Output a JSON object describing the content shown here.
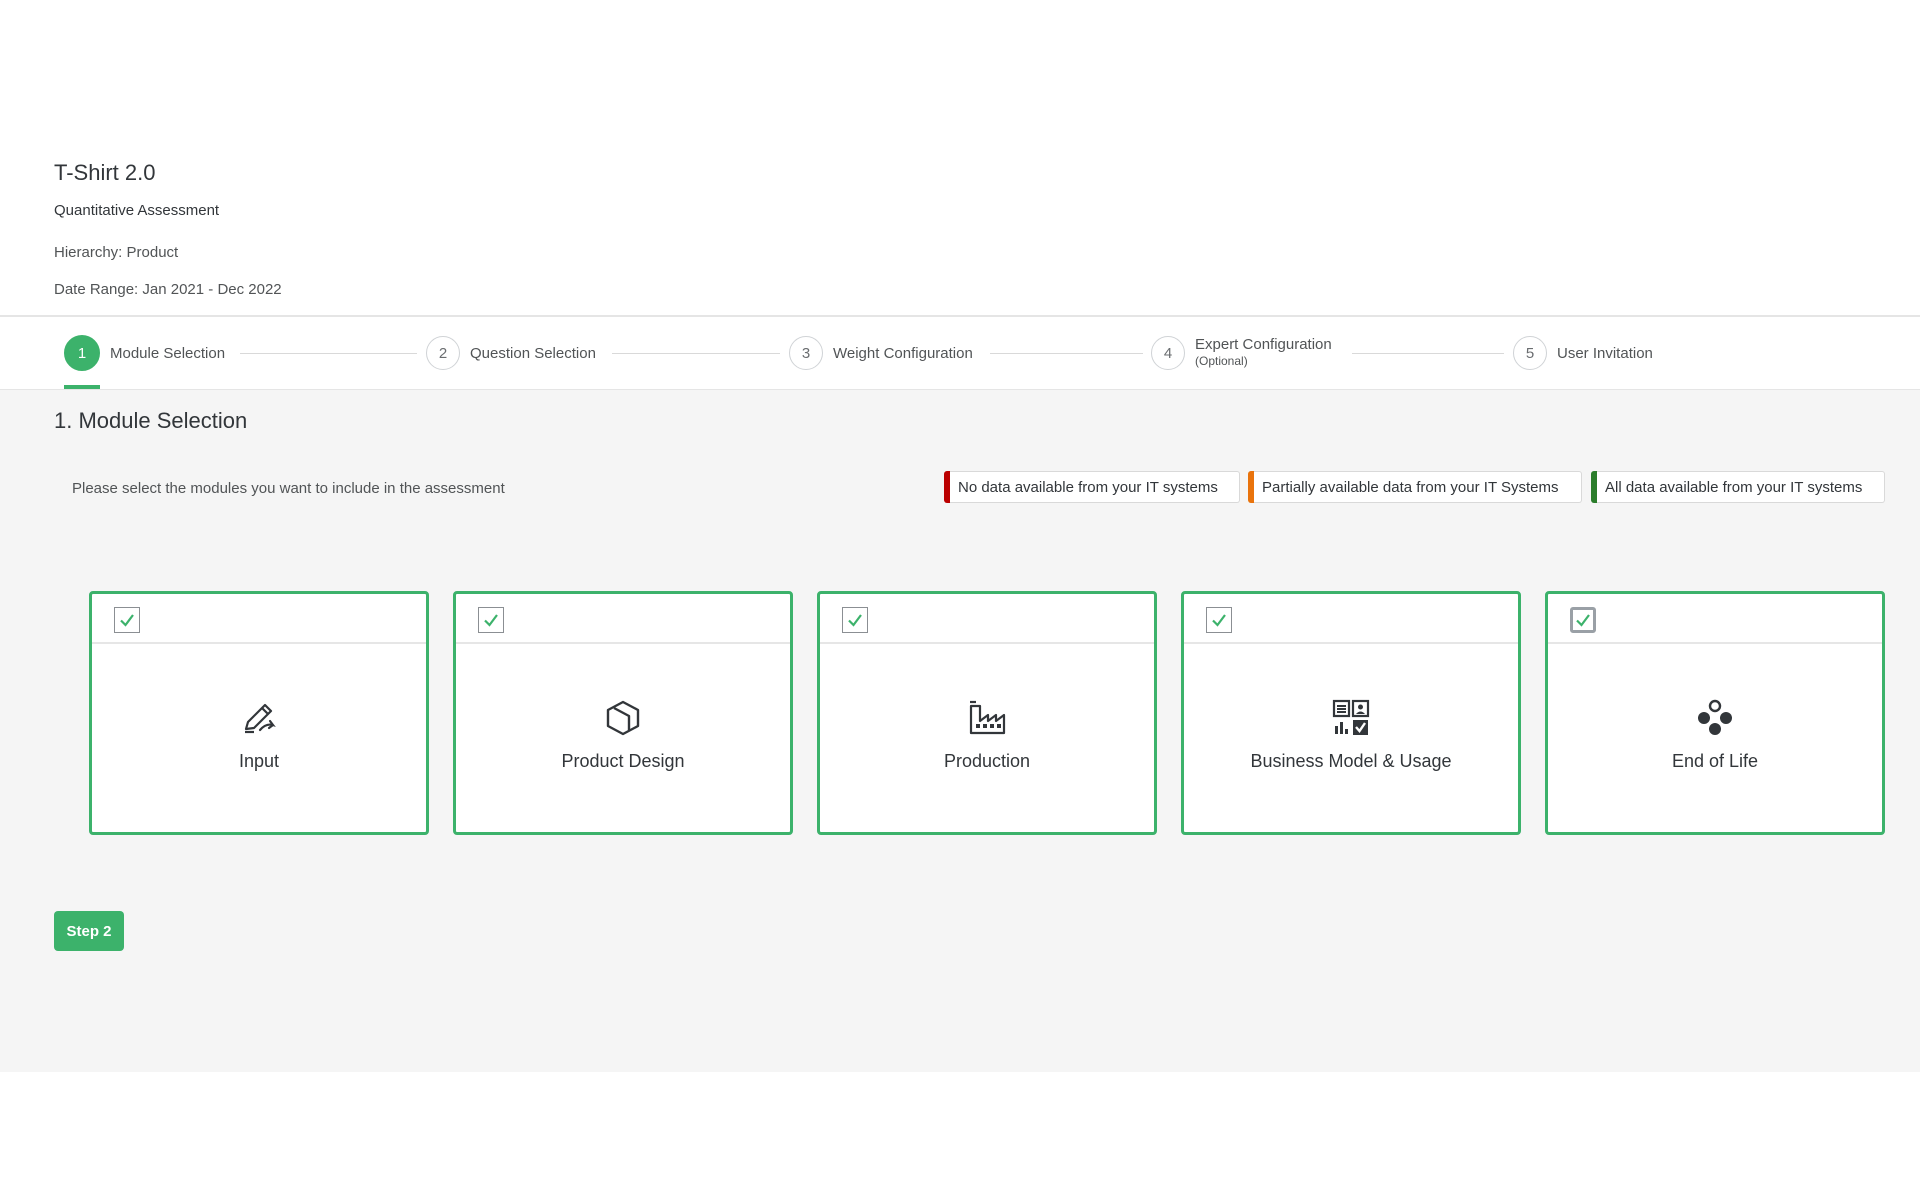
{
  "header": {
    "title": "T-Shirt 2.0",
    "subtitle": "Quantitative Assessment",
    "hierarchy": "Hierarchy: Product",
    "date_range": "Date Range: Jan 2021 - Dec 2022"
  },
  "stepper": {
    "active_index": 1,
    "steps": [
      {
        "number": "1",
        "label": "Module Selection"
      },
      {
        "number": "2",
        "label": "Question Selection"
      },
      {
        "number": "3",
        "label": "Weight Configuration"
      },
      {
        "number": "4",
        "label": "Expert Configuration",
        "sublabel": "(Optional)"
      },
      {
        "number": "5",
        "label": "User Invitation"
      }
    ]
  },
  "section": {
    "title": "1. Module Selection",
    "instruction": "Please select the modules you want to include in the assessment"
  },
  "legend": [
    {
      "label": "No data available from your IT systems",
      "color": "#bb0000"
    },
    {
      "label": "Partially available data from your IT Systems",
      "color": "#e9730c"
    },
    {
      "label": "All data available from your IT systems",
      "color": "#2b7d2b"
    }
  ],
  "modules": [
    {
      "label": "Input",
      "icon": "edit-pencil-icon",
      "checked": true
    },
    {
      "label": "Product Design",
      "icon": "product-box-icon",
      "checked": true
    },
    {
      "label": "Production",
      "icon": "factory-icon",
      "checked": true
    },
    {
      "label": "Business Model & Usage",
      "icon": "business-usage-icon",
      "checked": true
    },
    {
      "label": "End of Life",
      "icon": "circles-icon",
      "checked": true
    }
  ],
  "actions": {
    "next_label": "Step 2"
  },
  "colors": {
    "accent": "#3cb26b",
    "content_bg": "#f5f5f5"
  }
}
